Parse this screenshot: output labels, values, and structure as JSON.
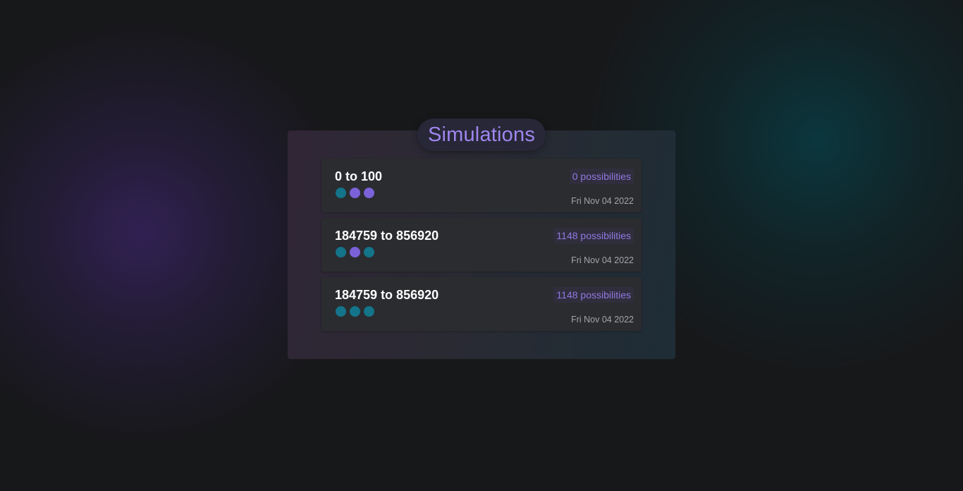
{
  "page": {
    "title": "Simulations"
  },
  "colors": {
    "teal_dot": "#13748a",
    "purple_dot": "#7b62d8",
    "accent": "#9f86ee"
  },
  "simulations": [
    {
      "title": "0 to 100",
      "possibilities": "0 possibilities",
      "date": "Fri Nov 04 2022",
      "dots": [
        "teal",
        "purple",
        "purple"
      ]
    },
    {
      "title": "184759 to 856920",
      "possibilities": "1148 possibilities",
      "date": "Fri Nov 04 2022",
      "dots": [
        "teal",
        "purple",
        "teal"
      ]
    },
    {
      "title": "184759 to 856920",
      "possibilities": "1148 possibilities",
      "date": "Fri Nov 04 2022",
      "dots": [
        "teal",
        "teal",
        "teal"
      ]
    }
  ]
}
